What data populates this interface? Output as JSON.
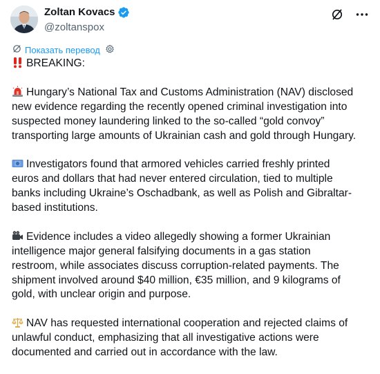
{
  "author": {
    "display_name": "Zoltan Kovacs",
    "handle": "@zoltanspox"
  },
  "translate": {
    "label": "Показать перевод"
  },
  "tweet": {
    "lines": [
      {
        "emoji": "double-exclamation-icon",
        "text": "BREAKING:"
      },
      {
        "emoji": "",
        "text": ""
      },
      {
        "emoji": "police-light-icon",
        "text": "Hungary’s National Tax and Customs Administration (NAV) disclosed"
      },
      {
        "emoji": "",
        "text": "new evidence regarding the recently opened criminal investigation into"
      },
      {
        "emoji": "",
        "text": "suspected money laundering linked to the so-called “gold convoy”"
      },
      {
        "emoji": "",
        "text": "transporting large amounts of Ukrainian cash and gold through Hungary."
      },
      {
        "emoji": "",
        "text": ""
      },
      {
        "emoji": "euro-banknote-icon",
        "text": "Investigators found that armored vehicles carried freshly printed"
      },
      {
        "emoji": "",
        "text": "euros and dollars that had never entered circulation, tied to multiple"
      },
      {
        "emoji": "",
        "text": "banks including Ukraine’s Oschadbank, as well as Polish and Gibraltar-"
      },
      {
        "emoji": "",
        "text": "based institutions."
      },
      {
        "emoji": "",
        "text": ""
      },
      {
        "emoji": "video-camera-icon",
        "text": "Evidence includes a video allegedly showing a former Ukrainian"
      },
      {
        "emoji": "",
        "text": "intelligence major general falsifying documents in a gas station"
      },
      {
        "emoji": "",
        "text": "restroom, while associates discuss corruption-related payments. The"
      },
      {
        "emoji": "",
        "text": "shipment involved around $40 million, €35 million, and 9 kilograms of"
      },
      {
        "emoji": "",
        "text": "gold, with unclear origin and purpose."
      },
      {
        "emoji": "",
        "text": ""
      },
      {
        "emoji": "balance-scale-icon",
        "text": "NAV has requested international cooperation and rejected claims of"
      },
      {
        "emoji": "",
        "text": "unlawful conduct, emphasizing that all investigative actions were"
      },
      {
        "emoji": "",
        "text": "documented and carried out in accordance with the law."
      }
    ]
  },
  "colors": {
    "text": "#0f1419",
    "secondary": "#536471",
    "link": "#1d9bf0",
    "verified": "#1d9bf0"
  }
}
